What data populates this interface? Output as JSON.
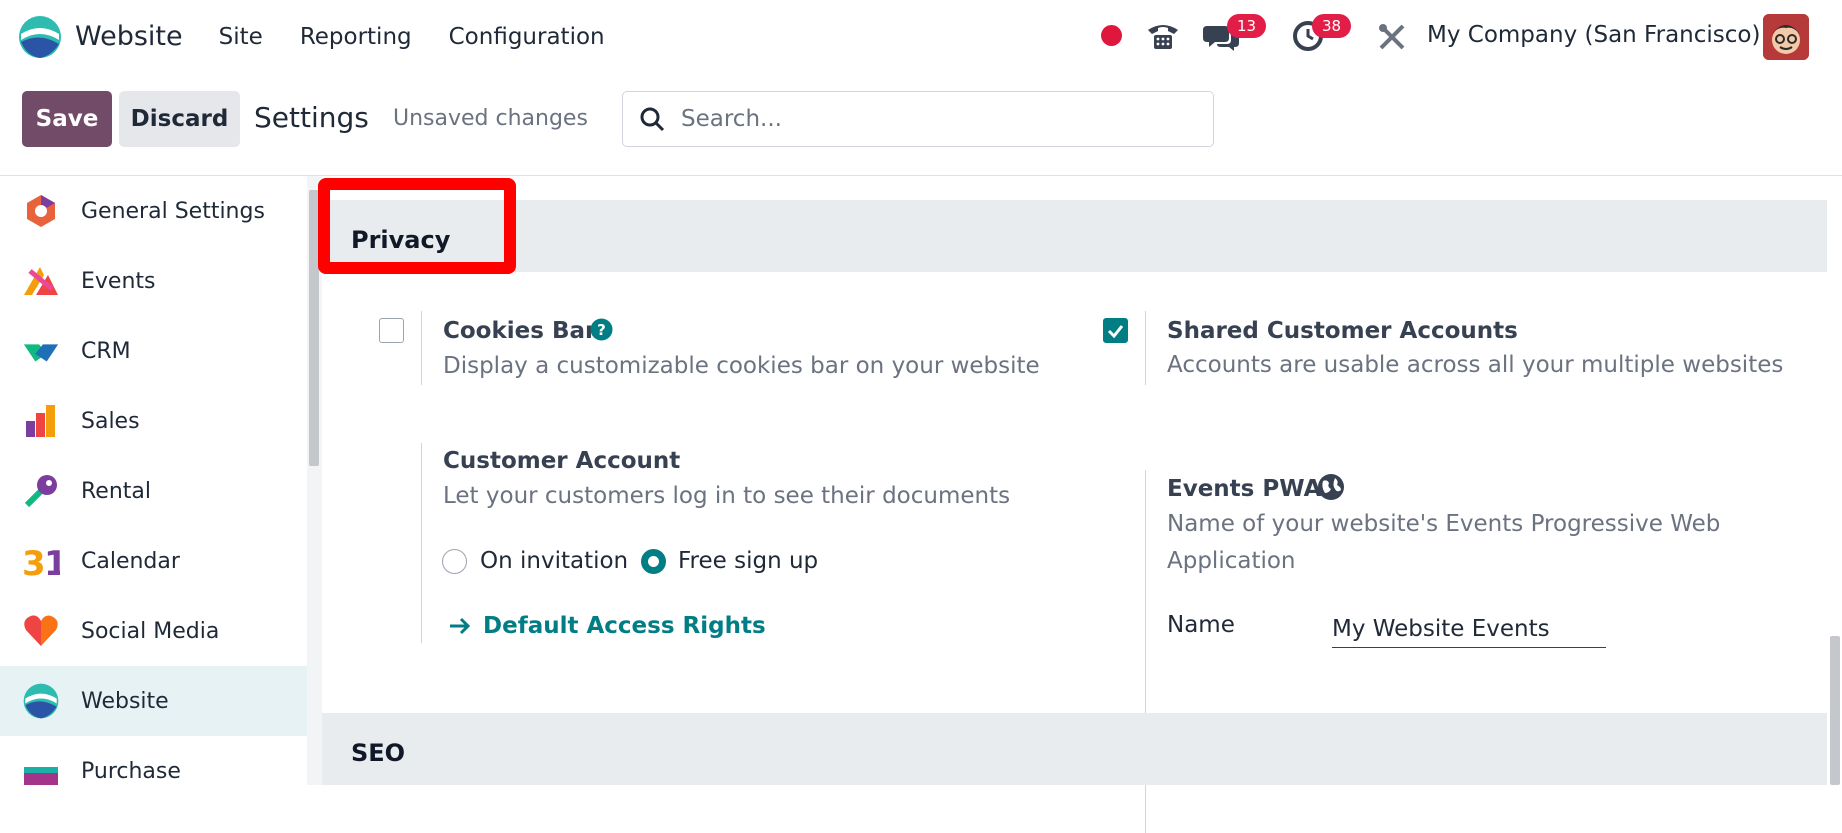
{
  "app": {
    "name": "Website"
  },
  "menu": [
    "Site",
    "Reporting",
    "Configuration"
  ],
  "systray": {
    "messages_count": "13",
    "activities_count": "38",
    "company": "My Company (San Francisco)"
  },
  "control": {
    "save_label": "Save",
    "discard_label": "Discard",
    "title": "Settings",
    "status": "Unsaved changes",
    "search_placeholder": "Search..."
  },
  "sidebar": {
    "items": [
      {
        "label": "General Settings",
        "icon": "general-settings-icon"
      },
      {
        "label": "Events",
        "icon": "events-icon"
      },
      {
        "label": "CRM",
        "icon": "crm-icon"
      },
      {
        "label": "Sales",
        "icon": "sales-icon"
      },
      {
        "label": "Rental",
        "icon": "rental-icon"
      },
      {
        "label": "Calendar",
        "icon": "calendar-icon"
      },
      {
        "label": "Social Media",
        "icon": "social-media-icon"
      },
      {
        "label": "Website",
        "icon": "website-icon",
        "active": true
      },
      {
        "label": "Purchase",
        "icon": "purchase-icon"
      }
    ]
  },
  "privacy": {
    "title": "Privacy",
    "cookies": {
      "title": "Cookies Bar",
      "desc": "Display a customizable cookies bar on your website",
      "checked": false
    },
    "shared": {
      "title": "Shared Customer Accounts",
      "desc": "Accounts are usable across all your multiple websites",
      "checked": true
    },
    "customer_account": {
      "title": "Customer Account",
      "desc": "Let your customers log in to see their documents",
      "option1": "On invitation",
      "option2": "Free sign up",
      "selected": "Free sign up",
      "link": "Default Access Rights"
    },
    "events_pwa": {
      "title": "Events PWA",
      "desc_line1": "Name of your website's Events Progressive Web",
      "desc_line2": "Application",
      "name_label": "Name",
      "name_value": "My Website Events"
    }
  },
  "seo": {
    "title": "SEO"
  },
  "colors": {
    "brand": "#714b67",
    "accent": "#017e84",
    "badge": "#e11d48",
    "highlight": "#ff0000"
  }
}
